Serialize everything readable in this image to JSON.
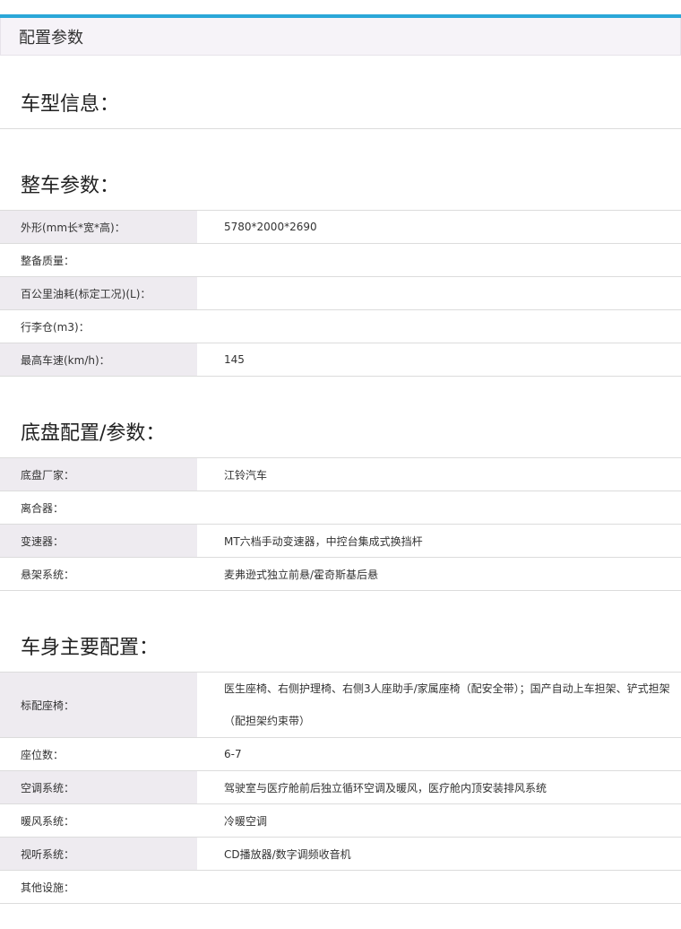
{
  "header": {
    "title": "配置参数"
  },
  "sections": [
    {
      "title": "车型信息：",
      "rows": []
    },
    {
      "title": "整车参数：",
      "rows": [
        {
          "label": "外形(mm长*宽*高)：",
          "value": "5780*2000*2690"
        },
        {
          "label": "整备质量：",
          "value": ""
        },
        {
          "label": "百公里油耗(标定工况)(L)：",
          "value": ""
        },
        {
          "label": "行李仓(m3)：",
          "value": ""
        },
        {
          "label": "最高车速(km/h)：",
          "value": "145"
        }
      ]
    },
    {
      "title": "底盘配置/参数：",
      "rows": [
        {
          "label": "底盘厂家：",
          "value": "江铃汽车"
        },
        {
          "label": "离合器：",
          "value": ""
        },
        {
          "label": "变速器：",
          "value": "MT六档手动变速器，中控台集成式换挡杆"
        },
        {
          "label": "悬架系统：",
          "value": "麦弗逊式独立前悬/霍奇斯基后悬"
        }
      ]
    },
    {
      "title": "车身主要配置：",
      "rows": [
        {
          "label": "标配座椅：",
          "value": "医生座椅、右侧护理椅、右侧3人座助手/家属座椅（配安全带）；国产自动上车担架、铲式担架（配担架约束带）"
        },
        {
          "label": "座位数：",
          "value": "6-7"
        },
        {
          "label": "空调系统：",
          "value": "驾驶室与医疗舱前后独立循环空调及暖风，医疗舱内顶安装排风系统"
        },
        {
          "label": "暖风系统：",
          "value": "冷暖空调"
        },
        {
          "label": "视听系统：",
          "value": "CD播放器/数字调频收音机"
        },
        {
          "label": "其他设施：",
          "value": ""
        }
      ]
    }
  ]
}
